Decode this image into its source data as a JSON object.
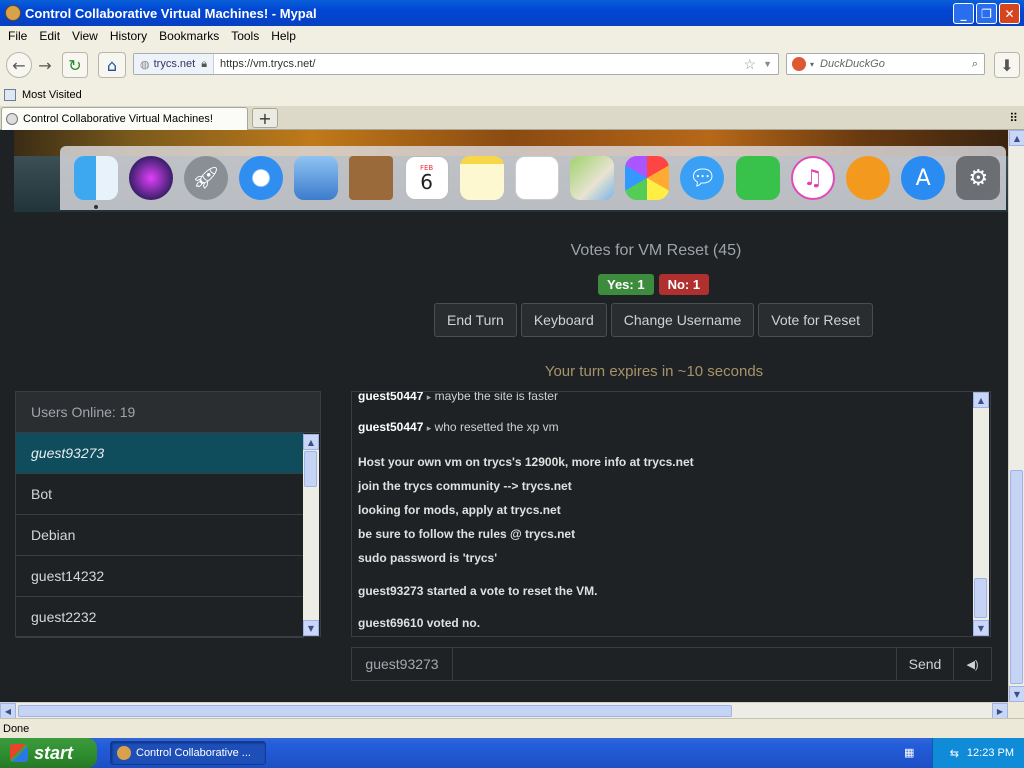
{
  "window": {
    "title": "Control Collaborative Virtual Machines! - Mypal"
  },
  "menu": [
    "File",
    "Edit",
    "View",
    "History",
    "Bookmarks",
    "Tools",
    "Help"
  ],
  "navbar": {
    "site_identity": "trycs.net",
    "url": "https://vm.trycs.net/",
    "search_placeholder": "DuckDuckGo"
  },
  "bookmarks": {
    "most_visited": "Most Visited"
  },
  "tab": {
    "label": "Control Collaborative Virtual Machines!",
    "new_tab": "+"
  },
  "dock": {
    "calendar_month": "FEB",
    "calendar_day": "6",
    "items": [
      "finder-icon",
      "siri-icon",
      "launchpad-icon",
      "safari-icon",
      "mail-icon",
      "contacts-icon",
      "calendar-icon",
      "notes-icon",
      "reminders-icon",
      "maps-icon",
      "photos-icon",
      "messages-icon",
      "facetime-icon",
      "itunes-icon",
      "books-icon",
      "appstore-icon",
      "system-preferences-icon"
    ]
  },
  "vote": {
    "title": "Votes for VM Reset (45)",
    "yes": "Yes: 1",
    "no": "No: 1"
  },
  "buttons": {
    "end_turn": "End Turn",
    "keyboard": "Keyboard",
    "change_username": "Change Username",
    "vote_reset": "Vote for Reset"
  },
  "turn_text": "Your turn expires in ~10 seconds",
  "users": {
    "header": "Users Online: 19",
    "list": [
      "guest93273",
      "Bot",
      "Debian",
      "guest14232",
      "guest2232"
    ]
  },
  "chat": {
    "messages": [
      {
        "user": "guest50447",
        "arrow": "▸",
        "text": "maybe the site is faster"
      },
      {
        "user": "guest50447",
        "arrow": "▸",
        "text": "who resetted the xp vm"
      }
    ],
    "system": [
      "Host your own vm on trycs's 12900k, more info at trycs.net",
      "join the trycs community --> trycs.net",
      "looking for mods, apply at trycs.net",
      "be sure to follow the rules @ trycs.net",
      "sudo password is 'trycs'"
    ],
    "events": [
      "guest93273 started a vote to reset the VM.",
      "guest69610 voted no."
    ]
  },
  "input": {
    "username": "guest93273",
    "send": "Send",
    "volume": "◀)"
  },
  "status": "Done",
  "taskbar": {
    "start": "start",
    "task": "Control Collaborative ...",
    "time": "12:23 PM"
  }
}
